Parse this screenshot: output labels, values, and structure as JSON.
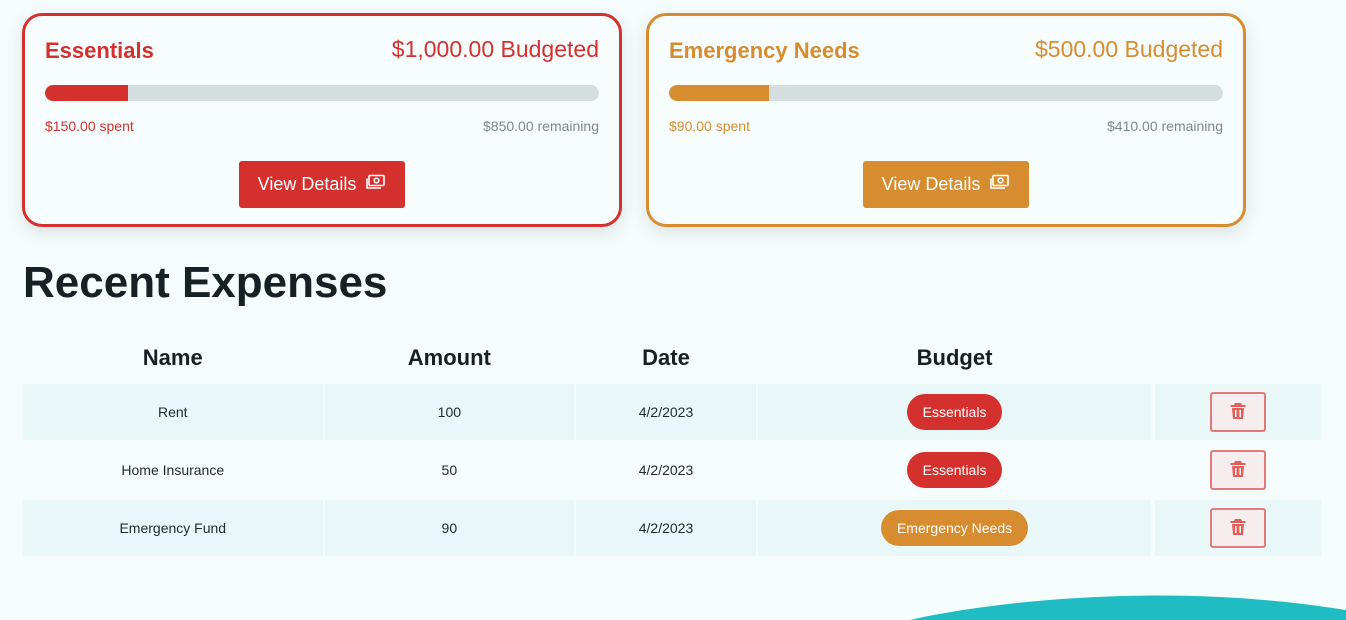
{
  "budgets": [
    {
      "name": "Essentials",
      "budgeted_label": "$1,000.00 Budgeted",
      "spent_label": "$150.00 spent",
      "remaining_label": "$850.00 remaining",
      "progress": 0.15,
      "color": "#d3302e",
      "button_label": "View Details",
      "button_icon": "banknote-icon"
    },
    {
      "name": "Emergency Needs",
      "budgeted_label": "$500.00 Budgeted",
      "spent_label": "$90.00 spent",
      "remaining_label": "$410.00 remaining",
      "progress": 0.18,
      "color": "#d78c2f",
      "button_label": "View Details",
      "button_icon": "banknote-icon"
    }
  ],
  "expenses": {
    "title": "Recent Expenses",
    "columns": [
      "Name",
      "Amount",
      "Date",
      "Budget"
    ],
    "rows": [
      {
        "name": "Rent",
        "amount": "100",
        "date": "4/2/2023",
        "budget": "Essentials",
        "budget_color": "#d3302e"
      },
      {
        "name": "Home Insurance",
        "amount": "50",
        "date": "4/2/2023",
        "budget": "Essentials",
        "budget_color": "#d3302e"
      },
      {
        "name": "Emergency Fund",
        "amount": "90",
        "date": "4/2/2023",
        "budget": "Emergency Needs",
        "budget_color": "#d78c2f"
      }
    ],
    "delete_icon": "trash-icon"
  },
  "colors": {
    "background": "#f5fcfc",
    "wave": "#1fbcc4",
    "delete_icon": "#e0605c"
  }
}
